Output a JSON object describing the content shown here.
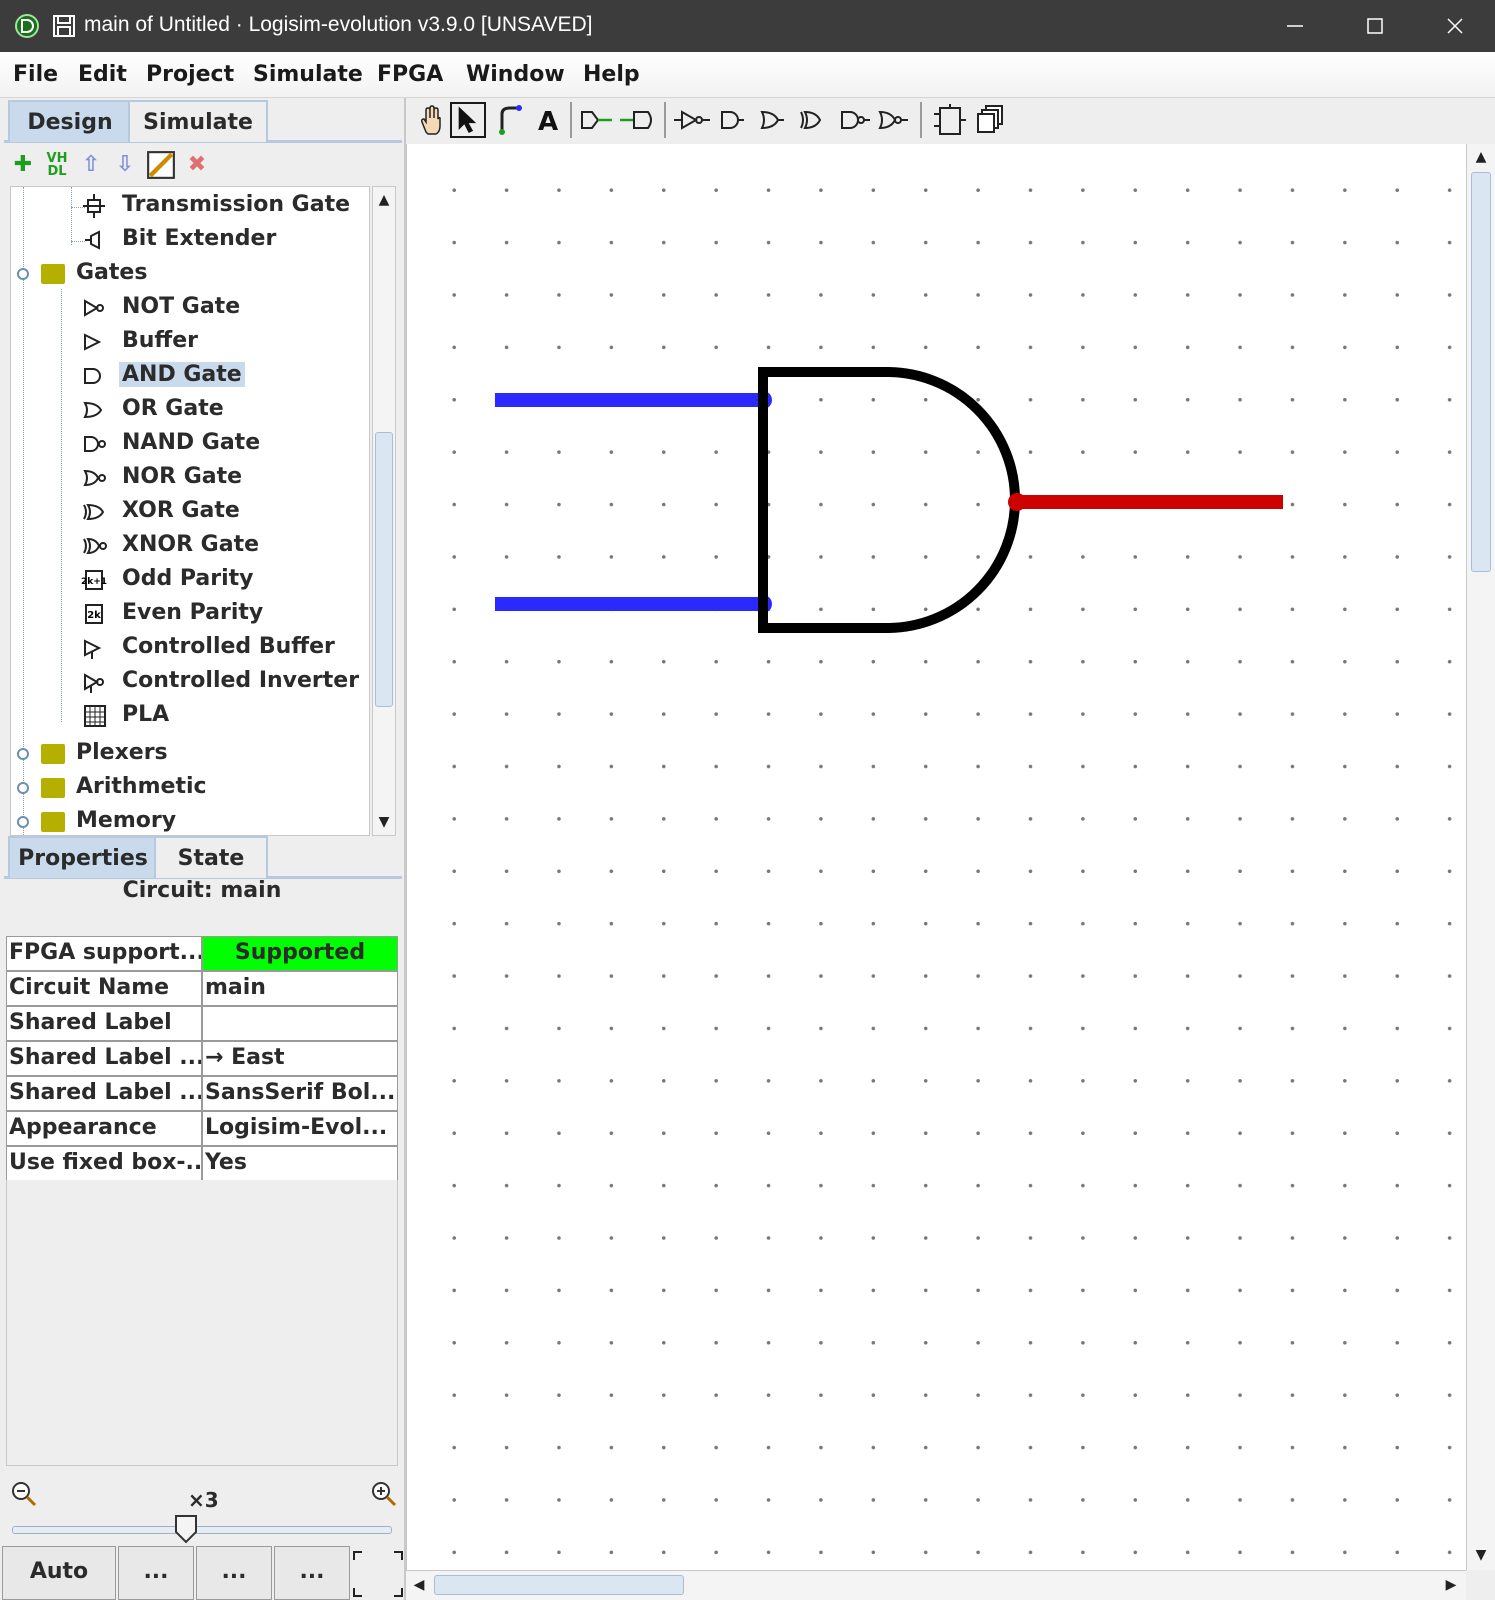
{
  "window": {
    "title": "main of Untitled · Logisim-evolution v3.9.0 [UNSAVED]"
  },
  "menu": [
    "File",
    "Edit",
    "Project",
    "Simulate",
    "FPGA",
    "Window",
    "Help"
  ],
  "explorer_tabs": [
    "Design",
    "Simulate"
  ],
  "library_toolbar": {
    "vhdl_label": "VH\nDL"
  },
  "tree": {
    "items": [
      {
        "label": "Transmission Gate",
        "icon": "transmission-gate-icon"
      },
      {
        "label": "Bit Extender",
        "icon": "bit-extender-icon"
      },
      {
        "label": "Gates",
        "icon": "folder-open-icon"
      },
      {
        "label": "NOT Gate",
        "icon": "not-gate-icon"
      },
      {
        "label": "Buffer",
        "icon": "buffer-icon"
      },
      {
        "label": "AND Gate",
        "icon": "and-gate-icon",
        "selected": true
      },
      {
        "label": "OR Gate",
        "icon": "or-gate-icon"
      },
      {
        "label": "NAND Gate",
        "icon": "nand-gate-icon"
      },
      {
        "label": "NOR Gate",
        "icon": "nor-gate-icon"
      },
      {
        "label": "XOR Gate",
        "icon": "xor-gate-icon"
      },
      {
        "label": "XNOR Gate",
        "icon": "xnor-gate-icon"
      },
      {
        "label": "Odd Parity",
        "icon": "odd-parity-icon"
      },
      {
        "label": "Even Parity",
        "icon": "even-parity-icon"
      },
      {
        "label": "Controlled Buffer",
        "icon": "controlled-buffer-icon"
      },
      {
        "label": "Controlled Inverter",
        "icon": "controlled-inverter-icon"
      },
      {
        "label": "PLA",
        "icon": "pla-icon"
      },
      {
        "label": "Plexers",
        "icon": "folder-icon"
      },
      {
        "label": "Arithmetic",
        "icon": "folder-icon"
      },
      {
        "label": "Memory",
        "icon": "folder-icon"
      }
    ]
  },
  "props_tabs": [
    "Properties",
    "State"
  ],
  "properties": {
    "header": "Circuit: main",
    "rows": [
      {
        "key": "FPGA support...",
        "value": "Supported"
      },
      {
        "key": "Circuit Name",
        "value": "main"
      },
      {
        "key": "Shared Label",
        "value": ""
      },
      {
        "key": "Shared Label ...",
        "value": "→ East"
      },
      {
        "key": "Shared Label ...",
        "value": "SansSerif Bol..."
      },
      {
        "key": "Appearance",
        "value": "Logisim-Evol..."
      },
      {
        "key": "Use fixed box-...",
        "value": "Yes"
      }
    ]
  },
  "zoom": {
    "label": "×3"
  },
  "bottom_buttons": [
    "Auto",
    "...",
    "...",
    "..."
  ],
  "colors": {
    "wire_input": "#2a2aff",
    "wire_output": "#cc0000",
    "supported": "#00ff00",
    "selection": "#c9daed"
  }
}
